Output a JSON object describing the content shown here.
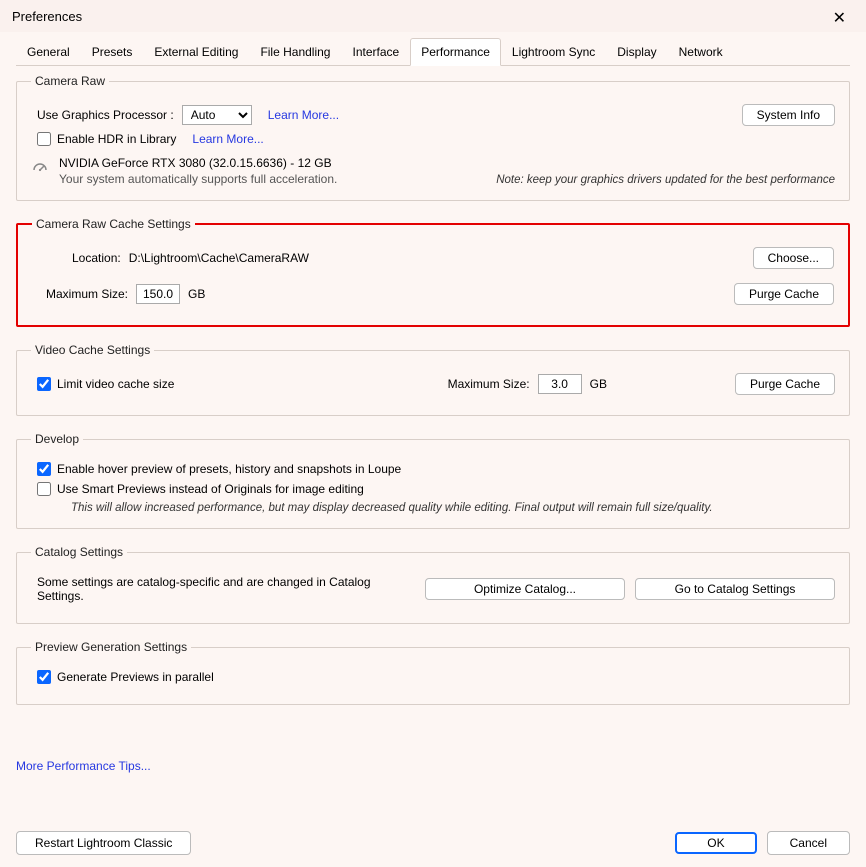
{
  "window": {
    "title": "Preferences"
  },
  "tabs": [
    "General",
    "Presets",
    "External Editing",
    "File Handling",
    "Interface",
    "Performance",
    "Lightroom Sync",
    "Display",
    "Network"
  ],
  "activeTab": "Performance",
  "cameraRaw": {
    "legend": "Camera Raw",
    "useGpuLabel": "Use Graphics Processor :",
    "gpuOptions": [
      "Auto"
    ],
    "gpuSelected": "Auto",
    "learnMore": "Learn More...",
    "systemInfo": "System Info",
    "enableHdr": "Enable HDR in Library",
    "learnMoreHdr": "Learn More...",
    "gpuName": "NVIDIA GeForce RTX 3080 (32.0.15.6636) - 12 GB",
    "gpuSupport": "Your system automatically supports full acceleration.",
    "driverNote": "Note: keep your graphics drivers updated for the best performance"
  },
  "cacheSettings": {
    "legend": "Camera Raw Cache Settings",
    "locationLabel": "Location:",
    "locationPath": "D:\\Lightroom\\Cache\\CameraRAW",
    "choose": "Choose...",
    "maxSizeLabel": "Maximum Size:",
    "maxSize": "150.0",
    "unit": "GB",
    "purge": "Purge Cache"
  },
  "videoCache": {
    "legend": "Video Cache Settings",
    "limitLabel": "Limit video cache size",
    "limitChecked": true,
    "maxSizeLabel": "Maximum Size:",
    "maxSize": "3.0",
    "unit": "GB",
    "purge": "Purge Cache"
  },
  "develop": {
    "legend": "Develop",
    "hoverPreview": "Enable hover preview of presets, history and snapshots in Loupe",
    "hoverChecked": true,
    "smartPreview": "Use Smart Previews instead of Originals for image editing",
    "smartChecked": false,
    "note": "This will allow increased performance, but may display decreased quality while editing. Final output will remain full size/quality."
  },
  "catalog": {
    "legend": "Catalog Settings",
    "text": "Some settings are catalog-specific and are changed in Catalog Settings.",
    "optimize": "Optimize Catalog...",
    "goto": "Go to Catalog Settings"
  },
  "preview": {
    "legend": "Preview Generation Settings",
    "label": "Generate Previews in parallel",
    "checked": true
  },
  "links": {
    "moreTips": "More Performance Tips..."
  },
  "footer": {
    "restart": "Restart Lightroom Classic",
    "ok": "OK",
    "cancel": "Cancel"
  }
}
